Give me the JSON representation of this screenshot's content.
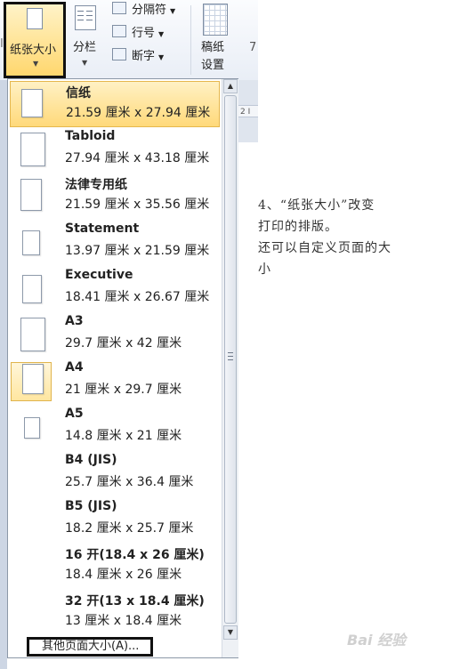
{
  "ribbon": {
    "paper_size_label": "纸张大小",
    "columns_label": "分栏",
    "breaks_label": "分隔符",
    "line_numbers_label": "行号",
    "hyphenation_label": "断字",
    "draft_label_1": "稿纸",
    "draft_label_2": "设置",
    "partial_label": "7",
    "left_partial": "I"
  },
  "ruler": {
    "text": "2 I"
  },
  "paper_sizes": [
    {
      "name": "信纸",
      "size": "21.59 厘米 x 27.94 厘米",
      "selected": true
    },
    {
      "name": "Tabloid",
      "size": "27.94 厘米 x 43.18 厘米"
    },
    {
      "name": "法律专用纸",
      "size": "21.59 厘米 x 35.56 厘米"
    },
    {
      "name": "Statement",
      "size": "13.97 厘米 x 21.59 厘米"
    },
    {
      "name": "Executive",
      "size": "18.41 厘米 x 26.67 厘米"
    },
    {
      "name": "A3",
      "size": "29.7 厘米 x 42 厘米"
    },
    {
      "name": "A4",
      "size": "21 厘米 x 29.7 厘米",
      "current": true
    },
    {
      "name": "A5",
      "size": "14.8 厘米 x 21 厘米"
    },
    {
      "name": "B4 (JIS)",
      "size": "25.7 厘米 x 36.4 厘米"
    },
    {
      "name": "B5 (JIS)",
      "size": "18.2 厘米 x 25.7 厘米"
    },
    {
      "name": "16 开(18.4 x 26 厘米)",
      "size": "18.4 厘米 x 26 厘米"
    },
    {
      "name": "32 开(13 x 18.4 厘米)",
      "size": "13 厘米 x 18.4 厘米"
    }
  ],
  "more_sizes_label": "其他页面大小(A)...",
  "note": {
    "line1": "4、“纸张大小”改变",
    "line2": "打印的排版。",
    "line3": "还可以自定义页面的大",
    "line4": "小"
  },
  "watermark": "Bai 经验",
  "colors": {
    "highlight": "#ffd97a",
    "border": "#111111"
  }
}
